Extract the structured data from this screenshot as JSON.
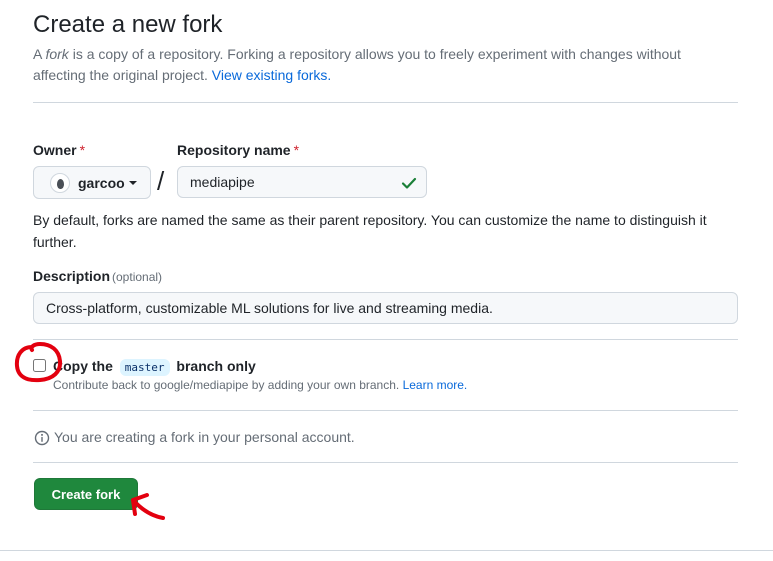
{
  "page": {
    "title": "Create a new fork",
    "subtitle_pre": "A ",
    "subtitle_em": "fork",
    "subtitle_post": " is a copy of a repository. Forking a repository allows you to freely experiment with changes without affecting the original project. ",
    "subtitle_link": "View existing forks."
  },
  "owner": {
    "label": "Owner",
    "required_mark": "*",
    "name": "garcoo"
  },
  "separator": "/",
  "repo": {
    "label": "Repository name",
    "required_mark": "*",
    "value": "mediapipe",
    "helper": "By default, forks are named the same as their parent repository. You can customize the name to distinguish it further."
  },
  "description": {
    "label": "Description",
    "optional": "(optional)",
    "value": "Cross-platform, customizable ML solutions for live and streaming media."
  },
  "copy_branch": {
    "pre": "Copy the",
    "branch": "master",
    "post": "branch only",
    "note": "Contribute back to google/mediapipe by adding your own branch. ",
    "learn_more": "Learn more.",
    "checked": false
  },
  "info": {
    "text": "You are creating a fork in your personal account."
  },
  "create_button": {
    "label": "Create fork",
    "color": "#1f883d"
  },
  "icons": {
    "valid": "check-icon",
    "info": "info-icon",
    "owner_dropdown": "caret-down-icon"
  },
  "colors": {
    "link": "#0969da",
    "required": "#cf222e",
    "annotation": "#e3000f"
  }
}
